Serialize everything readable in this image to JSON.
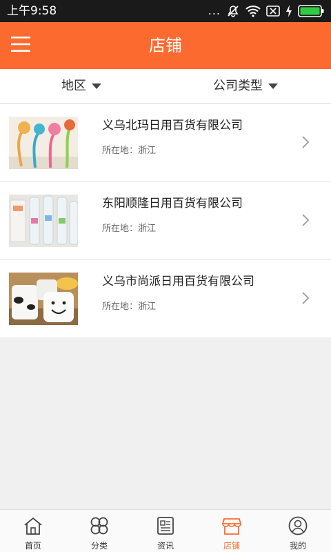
{
  "status_bar": {
    "time": "上午9:58",
    "dots": "..."
  },
  "app_bar": {
    "title": "店铺"
  },
  "filters": {
    "region": "地区",
    "company_type": "公司类型"
  },
  "shops": [
    {
      "name": "义乌北玛日用百货有限公司",
      "location": "所在地：浙江"
    },
    {
      "name": "东阳顺隆日用百货有限公司",
      "location": "所在地：浙江"
    },
    {
      "name": "义乌市尚派日用百货有限公司",
      "location": "所在地：浙江"
    }
  ],
  "tabs": [
    {
      "label": "首页",
      "icon": "home-icon"
    },
    {
      "label": "分类",
      "icon": "clover-icon"
    },
    {
      "label": "资讯",
      "icon": "news-icon"
    },
    {
      "label": "店铺",
      "icon": "shop-icon"
    },
    {
      "label": "我的",
      "icon": "user-icon"
    }
  ],
  "colors": {
    "accent": "#fd6a30",
    "status_bar": "#1a1a1a",
    "background": "#f0f0f0"
  }
}
